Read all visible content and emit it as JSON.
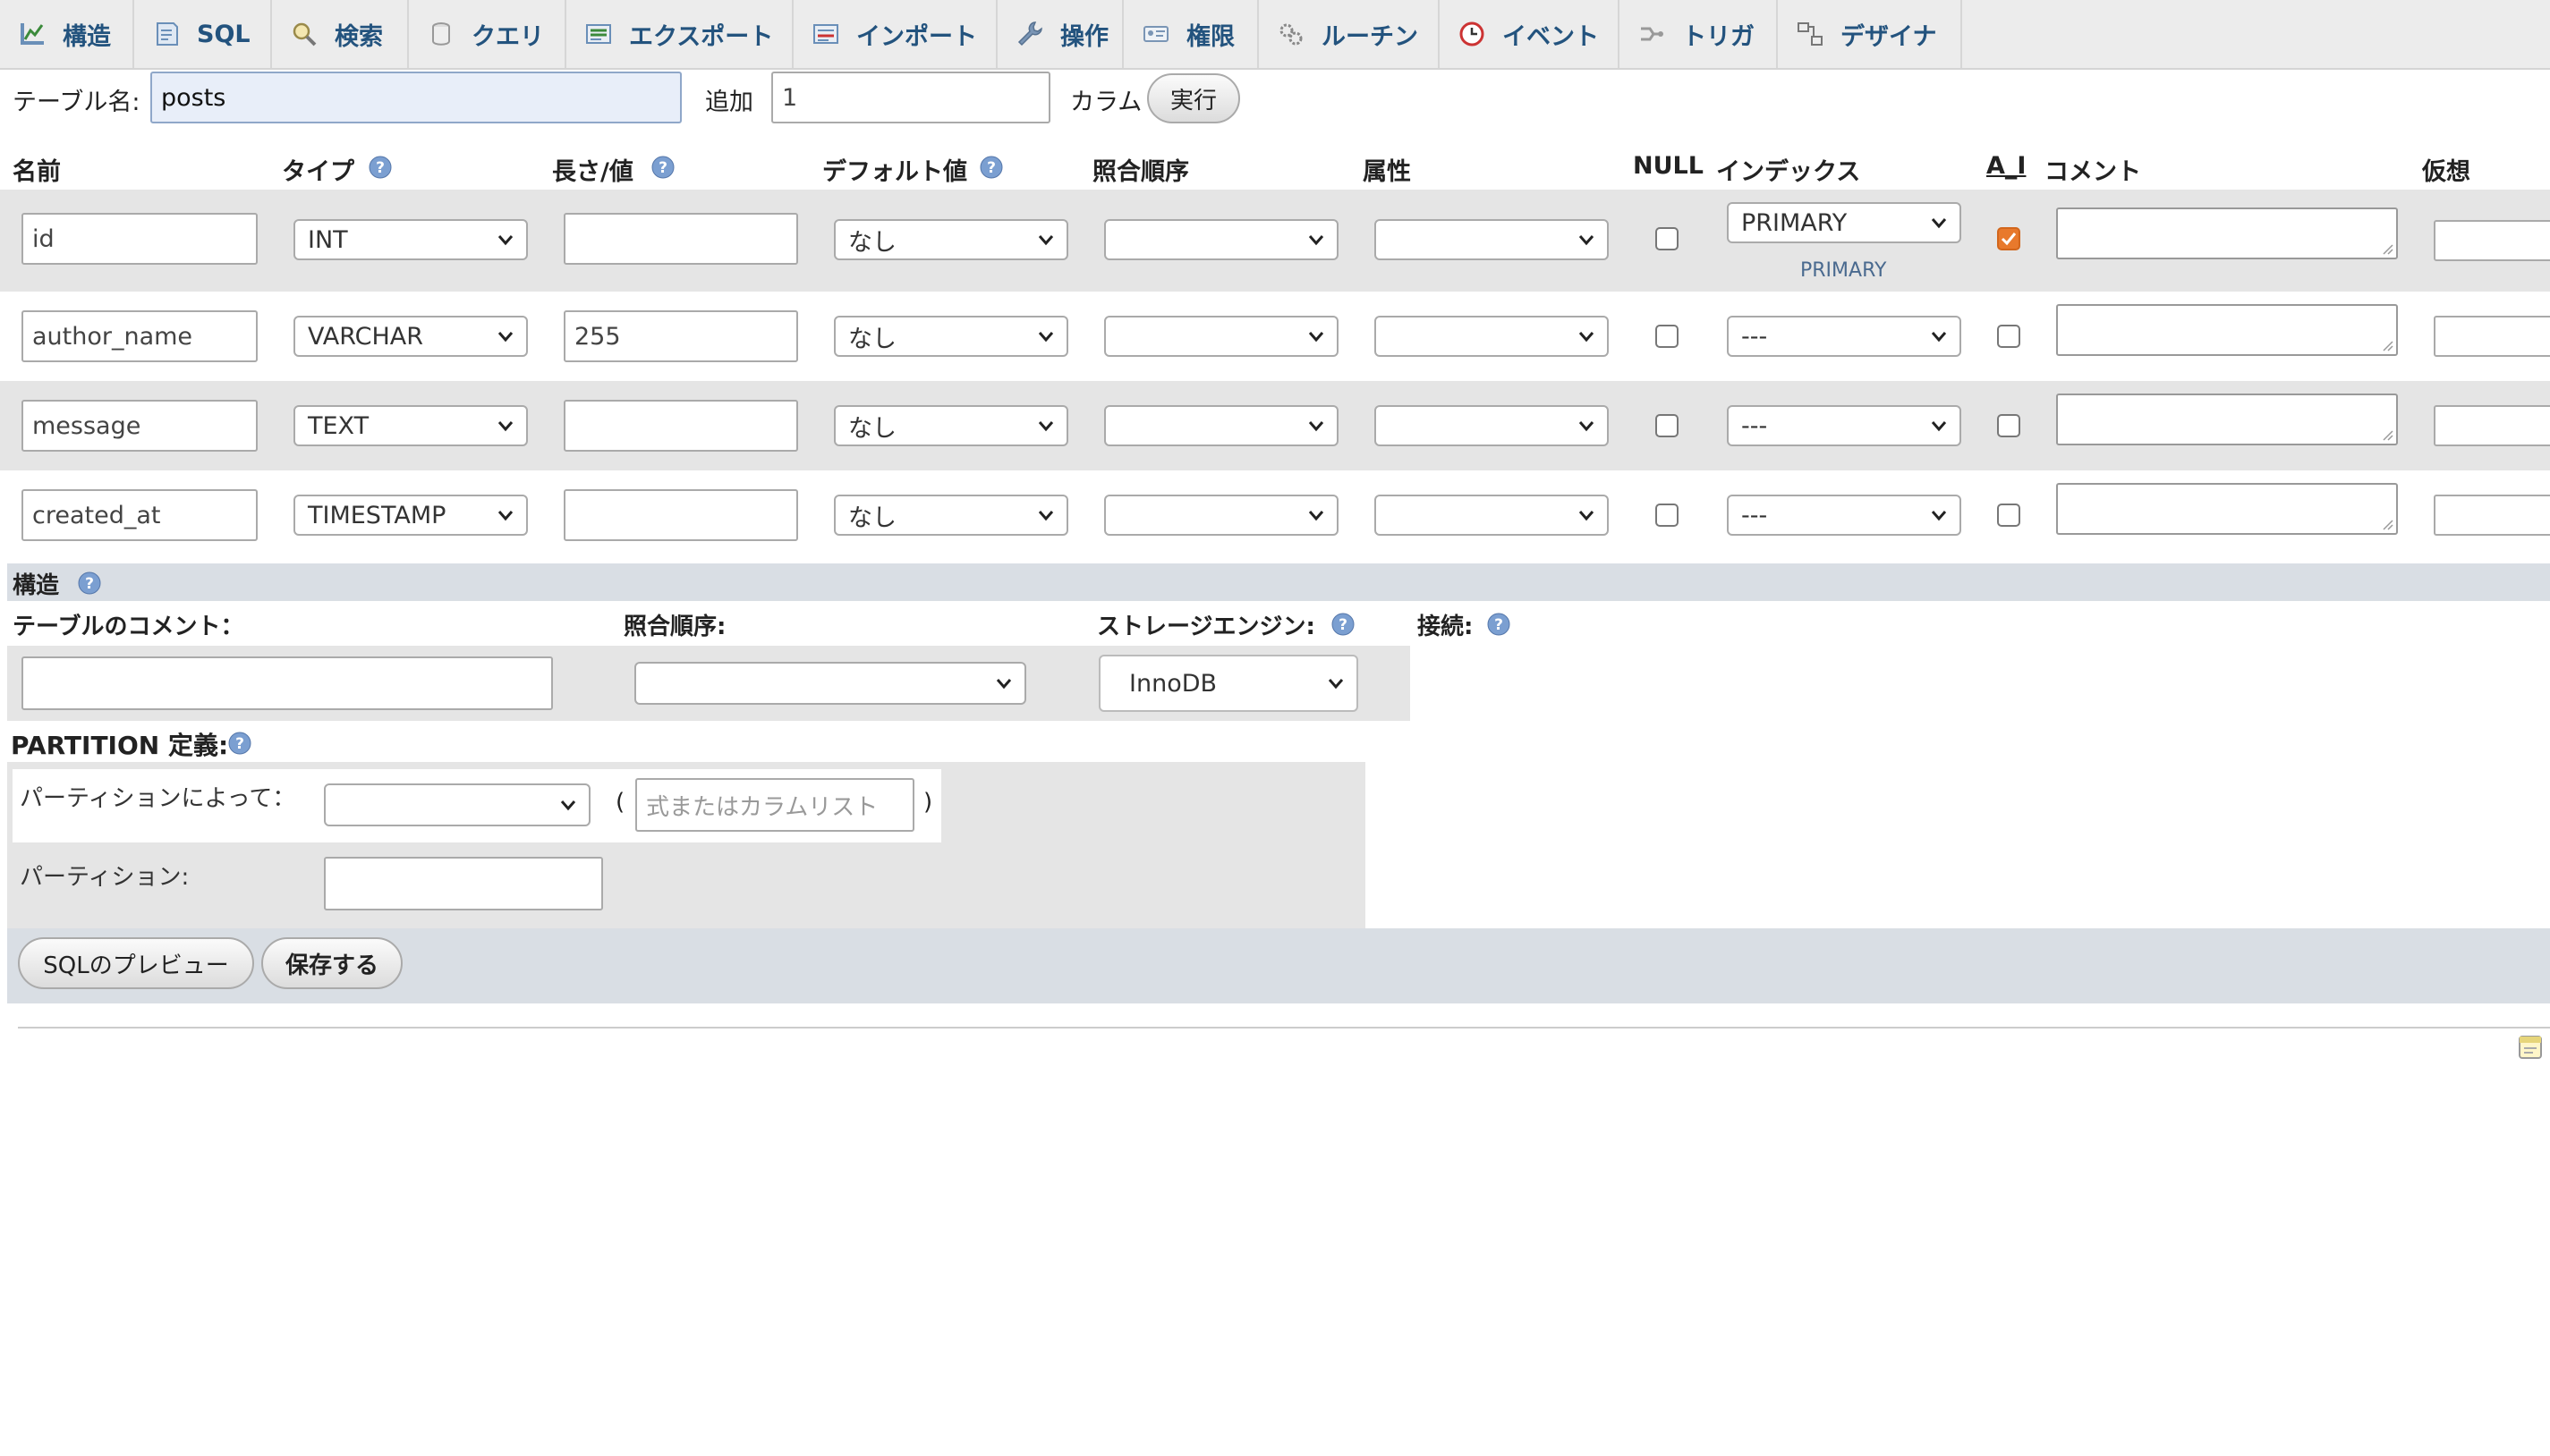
{
  "nav": {
    "tabs": [
      {
        "label": "構造",
        "icon": "structure-icon"
      },
      {
        "label": "SQL",
        "icon": "sql-icon"
      },
      {
        "label": "検索",
        "icon": "search-icon"
      },
      {
        "label": "クエリ",
        "icon": "query-icon"
      },
      {
        "label": "エクスポート",
        "icon": "export-icon"
      },
      {
        "label": "インポート",
        "icon": "import-icon"
      },
      {
        "label": "操作",
        "icon": "wrench-icon"
      },
      {
        "label": "権限",
        "icon": "privileges-icon"
      },
      {
        "label": "ルーチン",
        "icon": "routines-icon"
      },
      {
        "label": "イベント",
        "icon": "clock-icon"
      },
      {
        "label": "トリガ",
        "icon": "triggers-icon"
      },
      {
        "label": "デザイナ",
        "icon": "designer-icon"
      }
    ]
  },
  "form": {
    "table_name_label": "テーブル名:",
    "table_name_value": "posts",
    "add_label": "追加",
    "add_value": "1",
    "columns_label": "カラム",
    "go_button": "実行"
  },
  "headers": {
    "name": "名前",
    "type": "タイプ",
    "length": "長さ/値",
    "default": "デフォルト値",
    "collation": "照合順序",
    "attributes": "属性",
    "null": "NULL",
    "index": "インデックス",
    "ai": "A_I",
    "comment": "コメント",
    "virtual": "仮想"
  },
  "rows": [
    {
      "name": "id",
      "type": "INT",
      "length": "",
      "default": "なし",
      "collation": "",
      "attributes": "",
      "null": false,
      "index": "PRIMARY",
      "index_note": "PRIMARY",
      "ai": true
    },
    {
      "name": "author_name",
      "type": "VARCHAR",
      "length": "255",
      "default": "なし",
      "collation": "",
      "attributes": "",
      "null": false,
      "index": "---",
      "index_note": "",
      "ai": false
    },
    {
      "name": "message",
      "type": "TEXT",
      "length": "",
      "default": "なし",
      "collation": "",
      "attributes": "",
      "null": false,
      "index": "---",
      "index_note": "",
      "ai": false
    },
    {
      "name": "created_at",
      "type": "TIMESTAMP",
      "length": "",
      "default": "なし",
      "collation": "",
      "attributes": "",
      "null": false,
      "index": "---",
      "index_note": "",
      "ai": false
    }
  ],
  "structure": {
    "title": "構造",
    "table_comment_label": "テーブルのコメント：",
    "table_comment_value": "",
    "collation_label": "照合順序:",
    "collation_value": "",
    "storage_engine_label": "ストレージエンジン:",
    "storage_engine_value": "InnoDB",
    "connection_label": "接続:"
  },
  "partition": {
    "title": "PARTITION 定義:",
    "by_label": "パーティションによって：",
    "by_value": "",
    "paren_open": "(",
    "paren_close": ")",
    "expr_placeholder": "式またはカラムリスト",
    "partitions_label": "パーティション:",
    "partitions_value": ""
  },
  "actions": {
    "preview_sql": "SQLのプレビュー",
    "save": "保存する"
  },
  "colors": {
    "nav_bg": "#ececec",
    "nav_text": "#23537e",
    "row_gray": "#e5e5e5",
    "section_blue": "#d9dee4",
    "checkbox_on": "#e8792c"
  }
}
